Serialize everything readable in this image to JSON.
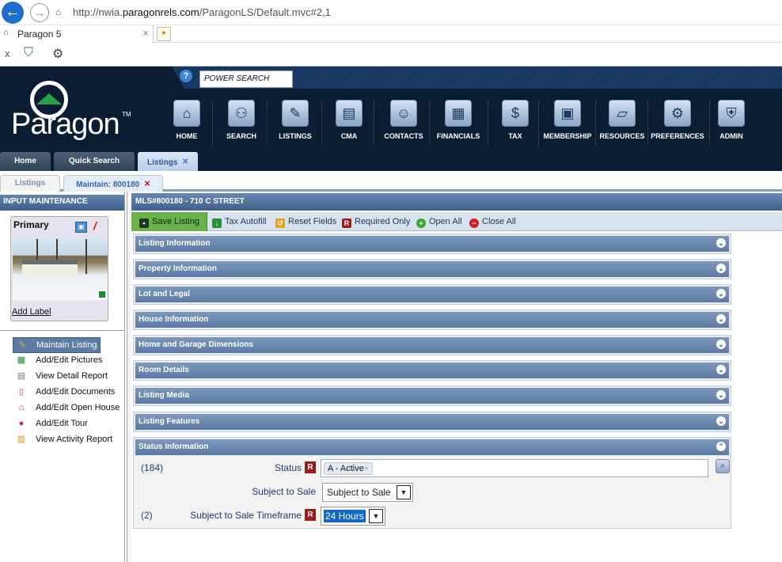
{
  "browser": {
    "url_prefix": "http://nwia.",
    "url_domain": "paragonrels.com",
    "url_path": "/ParagonLS/Default.mvc#2,1",
    "tab_title": "Paragon 5",
    "tab_close": "×",
    "cmd_close": "x"
  },
  "header": {
    "help": "?",
    "power_search": "POWER SEARCH",
    "logo": "Paragon",
    "logo_tm": "TM",
    "nav": [
      {
        "label": "HOME",
        "icon": "home-icon"
      },
      {
        "label": "SEARCH",
        "icon": "binoculars-icon"
      },
      {
        "label": "LISTINGS",
        "icon": "clipboard-icon"
      },
      {
        "label": "CMA",
        "icon": "document-icon"
      },
      {
        "label": "CONTACTS",
        "icon": "contacts-icon"
      },
      {
        "label": "FINANCIALS",
        "icon": "calculator-icon"
      },
      {
        "label": "TAX",
        "icon": "safe-icon"
      },
      {
        "label": "MEMBERSHIP",
        "icon": "briefcase-icon"
      },
      {
        "label": "RESOURCES",
        "icon": "folder-icon"
      },
      {
        "label": "PREFERENCES",
        "icon": "wrench-icon"
      },
      {
        "label": "ADMIN",
        "icon": "shield-icon"
      }
    ]
  },
  "app_tabs": [
    "Home",
    "Quick Search",
    "Listings"
  ],
  "sub_tabs": [
    "Listings",
    "Maintain: 800180"
  ],
  "left": {
    "title": "INPUT MAINTENANCE",
    "photo_title": "Primary",
    "add_label": "Add Label",
    "menu": [
      {
        "label": "Maintain Listing",
        "icon": "pencil-icon",
        "selected": true
      },
      {
        "label": "Add/Edit Pictures",
        "icon": "pictures-icon"
      },
      {
        "label": "View Detail Report",
        "icon": "report-icon"
      },
      {
        "label": "Add/Edit Documents",
        "icon": "documents-icon"
      },
      {
        "label": "Add/Edit Open House",
        "icon": "open-house-icon"
      },
      {
        "label": "Add/Edit Tour",
        "icon": "tour-icon"
      },
      {
        "label": "View Activity Report",
        "icon": "activity-chart-icon"
      }
    ]
  },
  "main": {
    "title": "MLS#800180 - 710 C STREET",
    "toolbar": {
      "save": "Save Listing",
      "tax_autofill": "Tax Autofill",
      "reset": "Reset Fields",
      "required_only": "Required Only",
      "required_badge": "R",
      "open_all": "Open All",
      "close_all": "Close All"
    },
    "sections": [
      "Listing Information",
      "Property Information",
      "Lot and Legal",
      "House Information",
      "Home and Garage Dimensions",
      "Room Details",
      "Listing Media",
      "Listing Features",
      "Status Information"
    ],
    "status": {
      "status_count": "(184)",
      "status_label": "Status",
      "status_value": "A - Active",
      "subject_label": "Subject to Sale",
      "subject_value": "Subject to Sale",
      "timeframe_count": "(2)",
      "timeframe_label": "Subject to Sale Timeframe",
      "timeframe_value": "24 Hours"
    }
  }
}
